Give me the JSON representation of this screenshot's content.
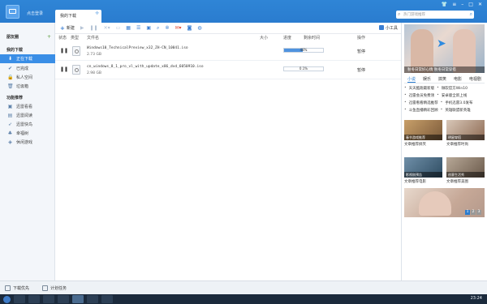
{
  "colors": {
    "header": "#2f85d6",
    "accent": "#3a8ee6",
    "progress": "#4f93df"
  },
  "header": {
    "login": "点击登录",
    "tab": "我的下载",
    "search_placeholder": "热门游戏推荐"
  },
  "sidebar": {
    "friends": "朋友圈",
    "my_downloads": "我的下载",
    "items": [
      {
        "label": "正在下载",
        "icon": "download-icon"
      },
      {
        "label": "已完成",
        "icon": "check-icon"
      },
      {
        "label": "私人空间",
        "icon": "lock-icon"
      },
      {
        "label": "垃圾箱",
        "icon": "trash-icon"
      }
    ],
    "featured": "功能推荐",
    "features": [
      {
        "label": "迅雷看看",
        "icon": "video-icon"
      },
      {
        "label": "迅雷阅读",
        "icon": "book-icon"
      },
      {
        "label": "迅雷快鸟",
        "icon": "bird-icon"
      },
      {
        "label": "幸福树",
        "icon": "tree-icon"
      },
      {
        "label": "休闲游戏",
        "icon": "gamepad-icon"
      }
    ]
  },
  "toolbar": {
    "new_label": "新建",
    "small_tools": "小工具"
  },
  "table": {
    "columns": {
      "status": "状态",
      "type": "类型",
      "filename": "文件名",
      "size": "大小",
      "progress": "进度",
      "remaining": "剩余时间",
      "state": "操作"
    },
    "rows": [
      {
        "name": "Windows10_TechnicalPreview_x32_ZH-CN_10041.iso",
        "size": "2.73 GB",
        "progress_label": "48%",
        "progress": 48,
        "remaining": "",
        "state": "暂停"
      },
      {
        "name": "cn_windows_8_1_pro_vl_with_update_x86_dvd_6050910.iso",
        "size": "2.98 GB",
        "progress_label": "0.1%",
        "progress": 0.1,
        "remaining": "",
        "state": "暂停"
      }
    ]
  },
  "right": {
    "hero_caption": "秋冬日常好心情 秋冬日常穿搭",
    "tabs": [
      "小说",
      "娱乐",
      "搞笑",
      "电影",
      "电视剧"
    ],
    "news": [
      "天天酷跑最新版",
      "微软官方Win10",
      "迅雷会员免费领",
      "安卓版全新上线",
      "迅雷看看精选推荐",
      "手机迅雷3.0发布",
      "斗鱼直播精彩回顾",
      "英雄联盟新英雄"
    ],
    "tiles": [
      {
        "caption": "春节游戏推荐",
        "label": "文章推荐搞笑"
      },
      {
        "caption": "明星穿搭",
        "label": "文章推荐时尚"
      },
      {
        "caption": "影视剧预告",
        "label": "文章推荐电影"
      },
      {
        "caption": "创意生活秀",
        "label": "文章推荐美图"
      }
    ],
    "pages": [
      "1",
      "2",
      "3"
    ]
  },
  "bottom": {
    "left": "下载优先",
    "right": "计划任务"
  },
  "taskbar": {
    "time": "23:24"
  }
}
